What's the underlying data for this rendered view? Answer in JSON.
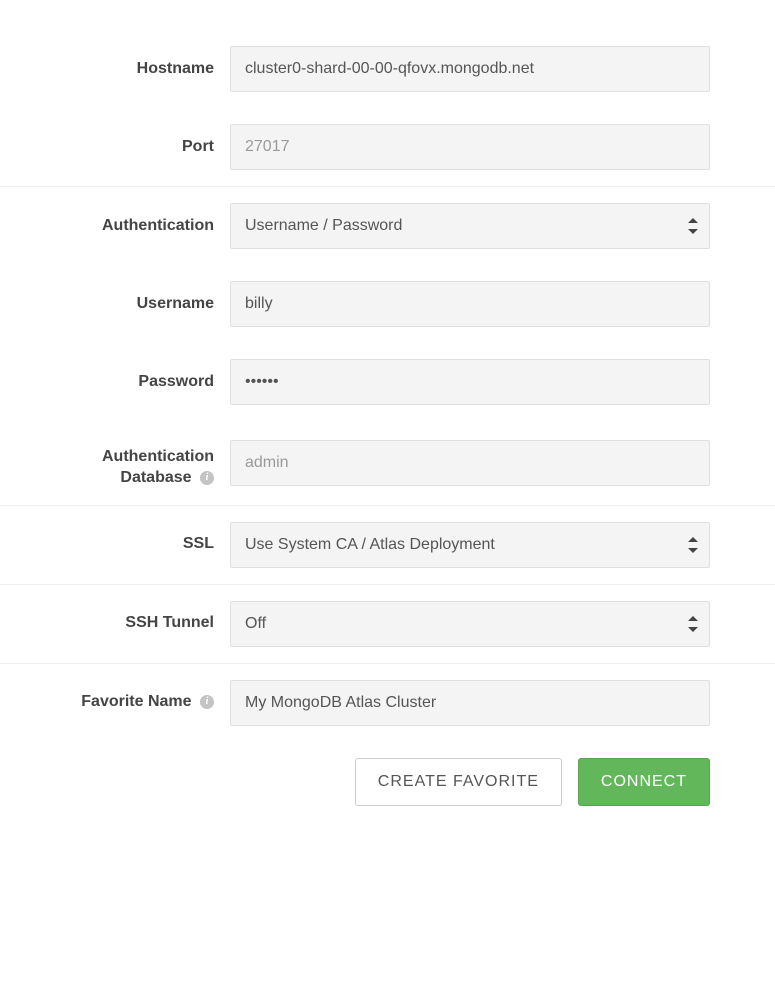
{
  "host": {
    "hostname_label": "Hostname",
    "hostname_value": "cluster0-shard-00-00-qfovx.mongodb.net",
    "port_label": "Port",
    "port_placeholder": "27017"
  },
  "auth": {
    "auth_label": "Authentication",
    "auth_value": "Username / Password",
    "username_label": "Username",
    "username_value": "billy",
    "password_label": "Password",
    "password_value": "••••••",
    "authdb_label_line1": "Authentication",
    "authdb_label_line2": "Database",
    "authdb_placeholder": "admin"
  },
  "ssl": {
    "ssl_label": "SSL",
    "ssl_value": "Use System CA / Atlas Deployment"
  },
  "ssh": {
    "ssh_label": "SSH Tunnel",
    "ssh_value": "Off"
  },
  "favorite": {
    "name_label": "Favorite Name",
    "name_value": "My MongoDB Atlas Cluster"
  },
  "buttons": {
    "create_favorite": "CREATE FAVORITE",
    "connect": "CONNECT"
  }
}
